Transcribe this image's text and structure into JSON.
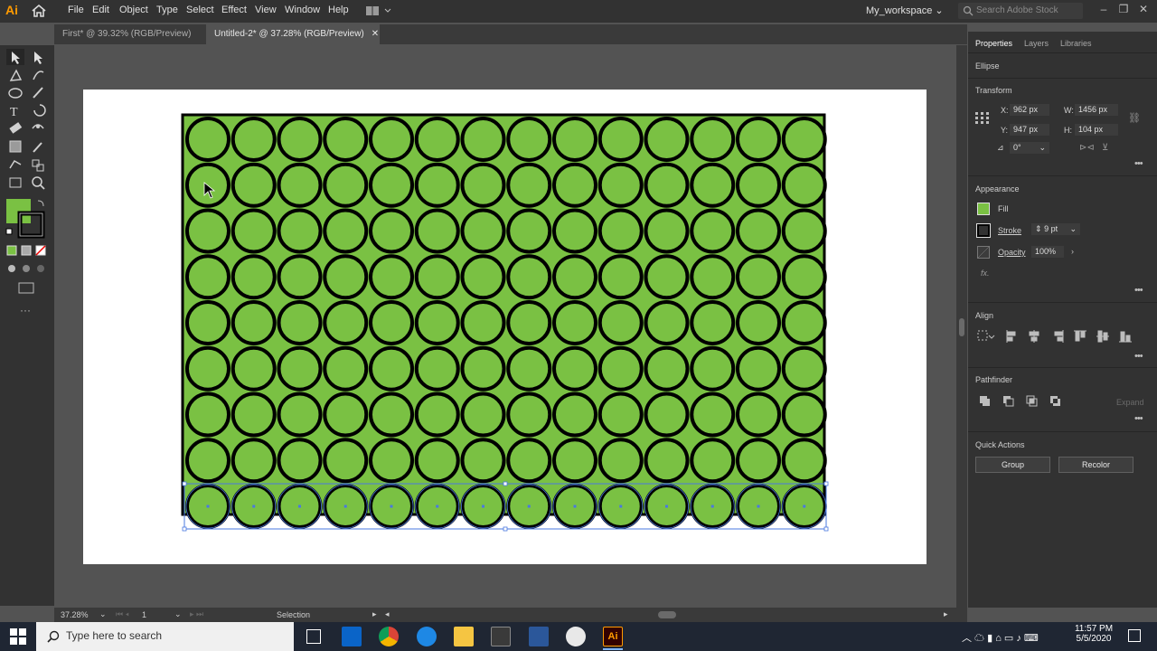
{
  "app": {
    "logo": "Ai",
    "menu": [
      "File",
      "Edit",
      "Object",
      "Type",
      "Select",
      "Effect",
      "View",
      "Window",
      "Help"
    ],
    "workspace": "My_workspace",
    "search_placeholder": "Search Adobe Stock"
  },
  "tabs": [
    {
      "label": "First* @ 39.32% (RGB/Preview)",
      "active": false
    },
    {
      "label": "Untitled-2* @ 37.28% (RGB/Preview)",
      "active": true
    }
  ],
  "panel": {
    "tabs": [
      "Properties",
      "Layers",
      "Libraries"
    ],
    "object_type": "Ellipse",
    "transform": {
      "title": "Transform",
      "x_label": "X:",
      "x": "962 px",
      "y_label": "Y:",
      "y": "947 px",
      "w_label": "W:",
      "w": "1456 px",
      "h_label": "H:",
      "h": "104 px",
      "angle": "0°"
    },
    "appearance": {
      "title": "Appearance",
      "fill_label": "Fill",
      "stroke_label": "Stroke",
      "stroke_weight": "9 pt",
      "opacity_label": "Opacity",
      "opacity": "100%",
      "fx": "fx."
    },
    "align_title": "Align",
    "pathfinder_title": "Pathfinder",
    "expand_label": "Expand",
    "quick_actions": {
      "title": "Quick Actions",
      "group": "Group",
      "recolor": "Recolor"
    }
  },
  "status": {
    "zoom": "37.28%",
    "page": "1",
    "tool": "Selection"
  },
  "taskbar": {
    "search_placeholder": "Type here to search",
    "time": "11:57 PM",
    "date": "5/5/2020"
  },
  "colors": {
    "fill": "#7ac143",
    "stroke": "#000000",
    "selection": "#4a78e0",
    "accent": "#ff9a00"
  }
}
